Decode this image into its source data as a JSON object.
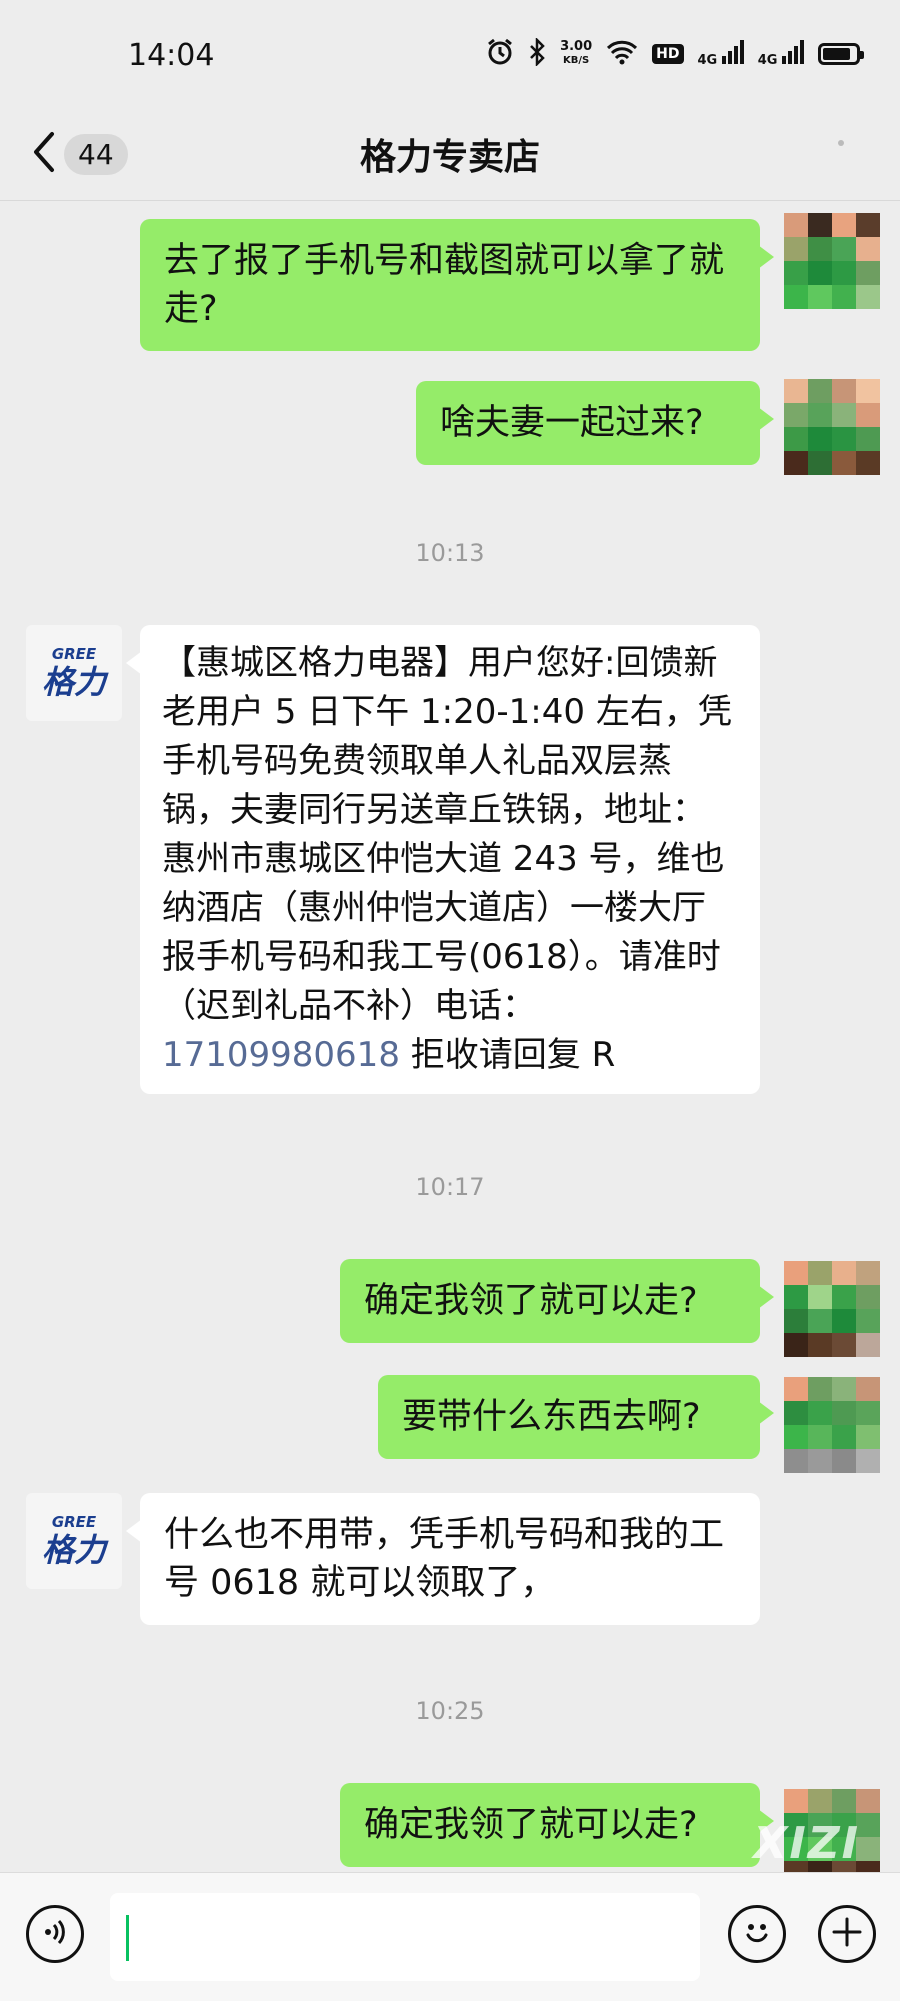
{
  "status": {
    "time": "14:04",
    "speed_value": "3.00",
    "speed_unit": "KB/S",
    "hd_label": "HD",
    "net1": "4G",
    "net2": "4G"
  },
  "nav": {
    "unread_count": "44",
    "title": "格力专卖店"
  },
  "messages": [
    {
      "text": "去了报了手机号和截图就可以拿了就走?"
    },
    {
      "text": "啥夫妻一起过来?"
    },
    {
      "text": "【惠城区格力电器】用户您好:回馈新老用户 5 日下午 1:20-1:40 左右，凭手机号码免费领取单人礼品双层蒸锅，夫妻同行另送章丘铁锅，地址：  惠州市惠城区仲恺大道 243 号，维也纳酒店（惠州仲恺大道店）一楼大厅报手机号码和我工号(0618）。请准时（迟到礼品不补）电话：",
      "phone": "17109980618",
      "tail": " 拒收请回复 R"
    },
    {
      "text": "确定我领了就可以走?"
    },
    {
      "text": "要带什么东西去啊?"
    },
    {
      "text": "什么也不用带，凭手机号码和我的工号 0618 就可以领取了，"
    },
    {
      "text": "确定我领了就可以走?"
    }
  ],
  "timestamps": [
    "10:13",
    "10:17",
    "10:25"
  ],
  "brand": {
    "en": "GREE",
    "cn": "格力"
  },
  "watermark": "XIZI",
  "icons": [
    "chevron-left-icon",
    "voice-icon",
    "emoji-icon",
    "plus-icon",
    "alarm-icon",
    "bluetooth-icon",
    "wifi-icon",
    "battery-icon"
  ],
  "colors": {
    "my_bubble": "#95ec69",
    "their_bubble": "#ffffff",
    "background": "#ededed",
    "link": "#576b95",
    "caret": "#07c160"
  }
}
